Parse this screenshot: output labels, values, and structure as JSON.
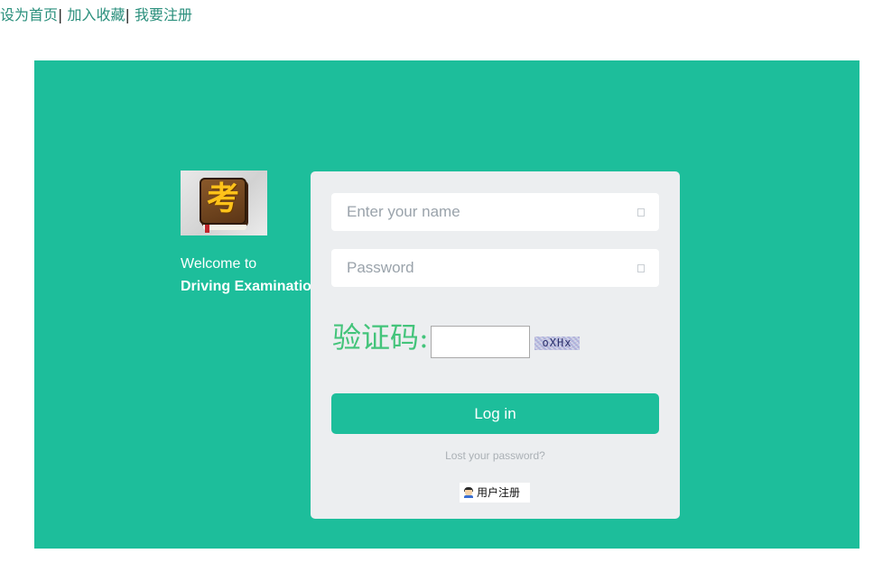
{
  "top_links": {
    "set_homepage": "设为首页",
    "separator": "|",
    "add_favorite": "加入收藏",
    "register": "我要注册"
  },
  "brand": {
    "logo_glyph": "考",
    "welcome_line1": "Welcome to",
    "welcome_line2": "Driving Examination!"
  },
  "login_form": {
    "name_placeholder": "Enter your name",
    "password_placeholder": "Password",
    "captcha_label": "验证码:",
    "captcha_value": "",
    "captcha_image_text": "oXHx",
    "login_button": "Log in",
    "lost_password": "Lost your password?",
    "user_register": "用户注册"
  },
  "colors": {
    "accent": "#1dbe9b",
    "card_bg": "#eceef0",
    "captcha_label": "#43c47a",
    "link": "#2a8f7c"
  }
}
